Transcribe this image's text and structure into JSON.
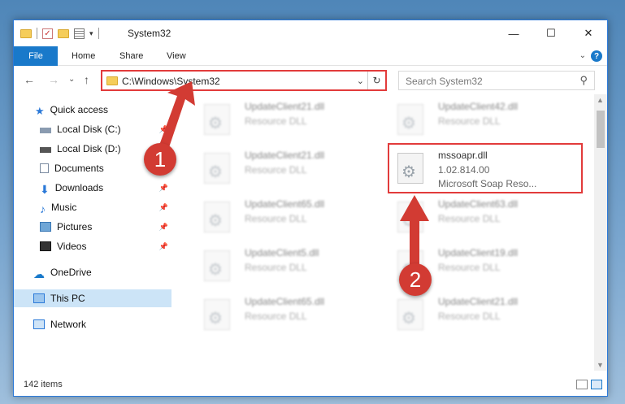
{
  "window": {
    "title": "System32",
    "min_glyph": "—",
    "max_glyph": "☐",
    "close_glyph": "✕"
  },
  "ribbon": {
    "tabs": [
      {
        "label": "File"
      },
      {
        "label": "Home"
      },
      {
        "label": "Share"
      },
      {
        "label": "View"
      }
    ],
    "help_glyph": "?"
  },
  "navigation": {
    "back_glyph": "←",
    "forward_glyph": "→",
    "recent_glyph": "⌄",
    "up_glyph": "↑",
    "address": "C:\\Windows\\System32",
    "refresh_glyph": "↻",
    "search_placeholder": "Search System32"
  },
  "sidebar": {
    "items": [
      {
        "label": "Quick access",
        "icon": "star-icon",
        "pinned": false
      },
      {
        "label": "Local Disk (C:)",
        "icon": "drive-icon",
        "pinned": true
      },
      {
        "label": "Local Disk (D:)",
        "icon": "drive-icon",
        "pinned": true
      },
      {
        "label": "Documents",
        "icon": "documents-icon",
        "pinned": true
      },
      {
        "label": "Downloads",
        "icon": "download-icon",
        "pinned": true
      },
      {
        "label": "Music",
        "icon": "music-icon",
        "pinned": true
      },
      {
        "label": "Pictures",
        "icon": "pictures-icon",
        "pinned": true
      },
      {
        "label": "Videos",
        "icon": "videos-icon",
        "pinned": true
      },
      {
        "label": "OneDrive",
        "icon": "cloud-icon",
        "pinned": false
      },
      {
        "label": "This PC",
        "icon": "computer-icon",
        "pinned": false,
        "selected": true
      },
      {
        "label": "Network",
        "icon": "network-icon",
        "pinned": false
      }
    ]
  },
  "files": [
    {
      "name": "UpdateClient21.dll",
      "desc": "Resource DLL"
    },
    {
      "name": "UpdateClient42.dll",
      "desc": "Resource DLL"
    },
    {
      "name": "UpdateClient21.dll",
      "desc": "Resource DLL"
    },
    {
      "name": "mssoapr.dll",
      "version": "1.02.814.00",
      "desc": "Microsoft Soap Reso..."
    },
    {
      "name": "UpdateClient65.dll",
      "desc": "Resource DLL"
    },
    {
      "name": "UpdateClient63.dll",
      "desc": "Resource DLL"
    },
    {
      "name": "UpdateClient5.dll",
      "desc": "Resource DLL"
    },
    {
      "name": "UpdateClient19.dll",
      "desc": "Resource DLL"
    },
    {
      "name": "UpdateClient65.dll",
      "desc": "Resource DLL"
    },
    {
      "name": "UpdateClient21.dll",
      "desc": "Resource DLL"
    }
  ],
  "status": {
    "count": "142 items"
  },
  "callouts": [
    {
      "number": "1"
    },
    {
      "number": "2"
    }
  ],
  "colors": {
    "accent": "#1979ca",
    "highlight": "#e23b3b",
    "callout": "#d23b33"
  }
}
